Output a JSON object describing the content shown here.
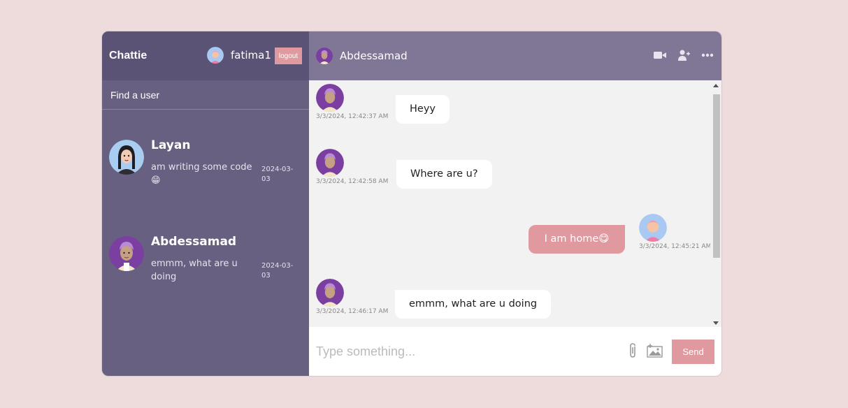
{
  "sidebar": {
    "logo": "Chattie",
    "current_user": {
      "name": "fatima1",
      "avatar": "girl-pink-hair-avatar"
    },
    "logout_label": "logout",
    "search_placeholder": "Find a user",
    "chats": [
      {
        "name": "Layan",
        "last_message": "am writing some code 😁",
        "date": "2024-03-03",
        "avatar": "girl-dark-hair-avatar"
      },
      {
        "name": "Abdessamad",
        "last_message": "emmm, what are u doing",
        "date": "2024-03-03",
        "avatar": "boy-purple-hair-avatar"
      }
    ]
  },
  "chat": {
    "header_name": "Abdessamad",
    "header_avatar": "boy-purple-hair-avatar",
    "icons": [
      "video-camera-icon",
      "add-user-icon",
      "more-icon"
    ],
    "messages": [
      {
        "text": "Heyy",
        "time": "3/3/2024, 12:42:37 AM",
        "owner": false
      },
      {
        "text": "Where are u?",
        "time": "3/3/2024, 12:42:58 AM",
        "owner": false
      },
      {
        "text": "I am home😋",
        "time": "3/3/2024, 12:45:21 AM",
        "owner": true
      },
      {
        "text": "emmm, what are u doing",
        "time": "3/3/2024, 12:46:17 AM",
        "owner": false
      }
    ]
  },
  "input": {
    "placeholder": "Type something...",
    "send_label": "Send",
    "icons": [
      "paperclip-icon",
      "image-icon"
    ]
  },
  "colors": {
    "background": "#eedcdd",
    "sidebar": "#676081",
    "sidebar_nav": "#5b5376",
    "chat_header": "#807796",
    "accent": "#e0999f"
  }
}
